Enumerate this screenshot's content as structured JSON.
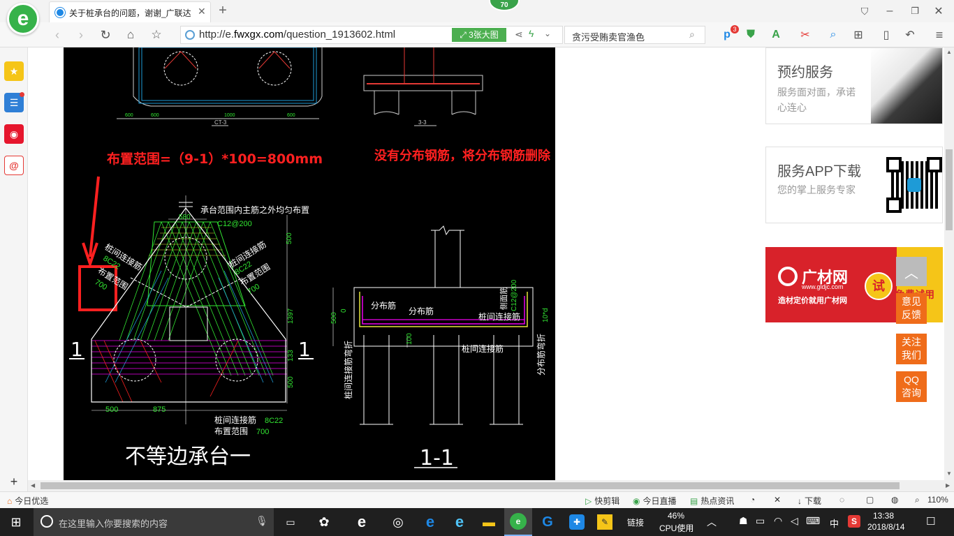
{
  "browser": {
    "tab_title": "关于桩承台的问题，谢谢_广联达",
    "update_badge": "70",
    "url_prefix": "http://e.",
    "url_domain": "fwxgx.com",
    "url_path": "/question_1913602.html",
    "image_mode_label": "3张大图",
    "search_text": "贪污受贿卖官渔色",
    "ext_badge": "3",
    "window_buttons": [
      "minimize",
      "restore",
      "close"
    ]
  },
  "drawing": {
    "annotation_range": "布置范围=（9-1）*100=800mm",
    "annotation_remove": "没有分布钢筋，将分布钢筋删除",
    "section_top_left": "CT-3",
    "section_top_right": "3-3",
    "note_main_bar": "承台范围内主筋之外均匀布置",
    "rebar_c12": "C12@200",
    "pile_link_bar": "桩间连接筋",
    "bar_8c22": "8C22",
    "layout_range": "布置范围",
    "range_700": "700",
    "dim_580": "580",
    "dim_500": "500",
    "dim_1397": "1397",
    "dim_133": "133",
    "dim_875": "875",
    "dim_100": "100",
    "dim_0": "0",
    "section_mark": "1",
    "title_left": "不等边承台一",
    "title_right": "1-1",
    "dist_bar": "分布筋",
    "side_bar": "侧面筋",
    "pile_link_bend": "桩间连接筋弯折",
    "dist_bar_bend": "分布筋弯折",
    "dim_10d": "10*d"
  },
  "side_panel": {
    "card1_title": "预约服务",
    "card1_desc": "服务面对面，承诺心连心",
    "card2_title": "服务APP下载",
    "card2_desc": "您的掌上服务专家",
    "ad_brand": "广材网",
    "ad_url": "www.gldjc.com",
    "ad_slogan": "造材定价就用广材网",
    "ad_try": "试",
    "ad_free": "免费试用",
    "float_feedback": "意见反馈",
    "float_follow": "关注我们",
    "float_qq": "QQ咨询"
  },
  "statusbar": {
    "today_pick": "今日优选",
    "quick_edit": "快剪辑",
    "today_live": "今日直播",
    "hot_news": "热点资讯",
    "download": "下载",
    "zoom": "110%"
  },
  "taskbar": {
    "search_placeholder": "在这里输入你要搜索的内容",
    "link_label": "链接",
    "cpu_percent": "46%",
    "cpu_label": "CPU使用",
    "ime": "中",
    "time": "13:38",
    "date": "2018/8/14"
  },
  "colors": {
    "accent_green": "#4caf50",
    "annotation_red": "#ff2020",
    "float_orange": "#ef6c1a",
    "ad_red": "#d8222a"
  }
}
